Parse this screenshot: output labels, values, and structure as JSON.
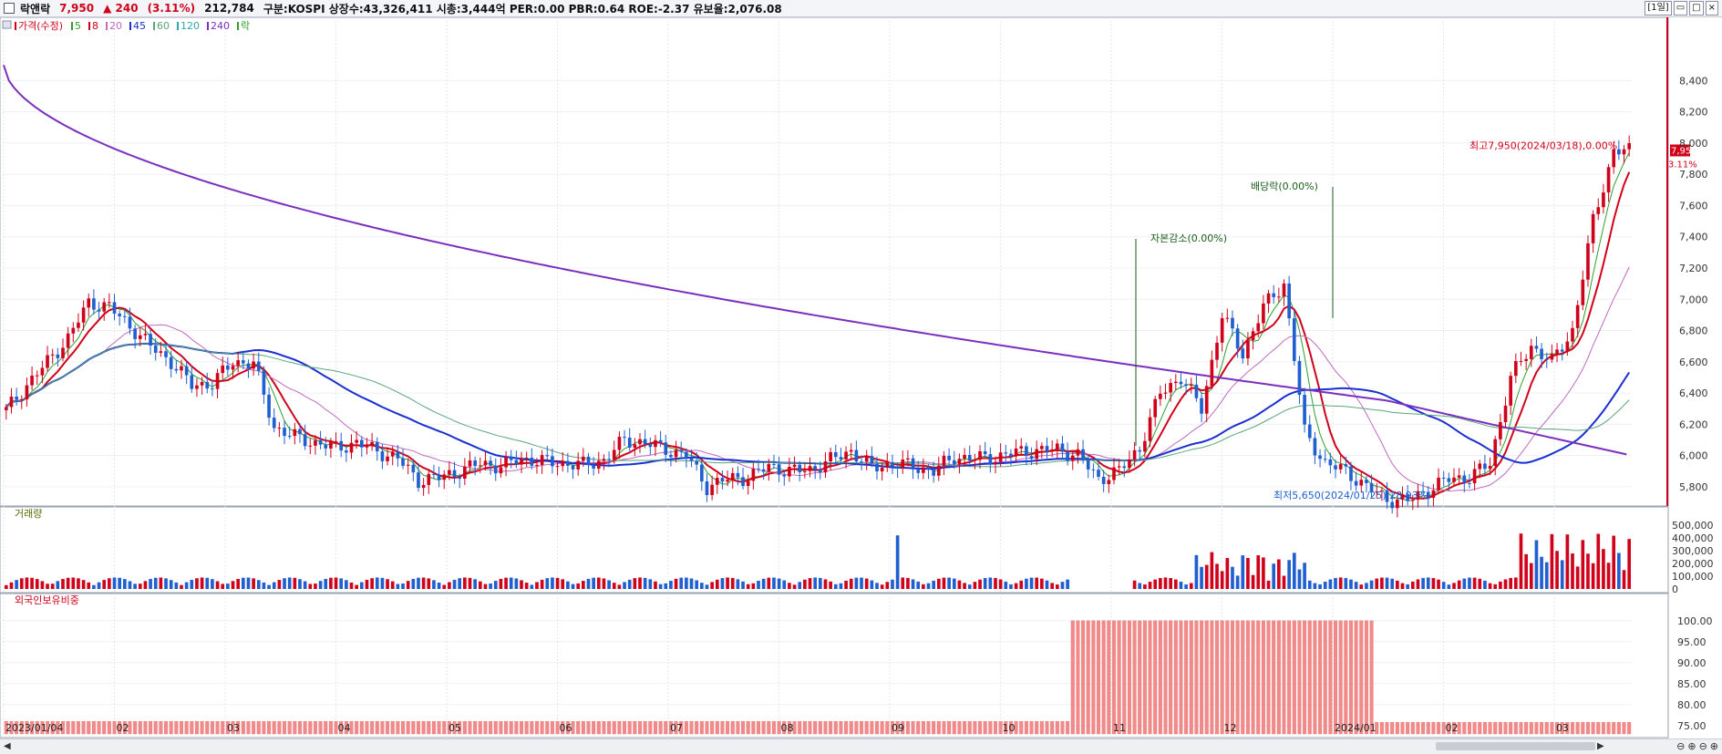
{
  "header": {
    "name": "락앤락",
    "price": "7,950",
    "change": "▲ 240",
    "change_pct": "(3.11%)",
    "volume": "212,784",
    "info": "구분:KOSPI 상장수:43,326,411 시총:3,444억 PER:0.00 PBR:0.64 ROE:-2.37 유보율:2,076.08",
    "period_button": "[1일]",
    "win_buttons": [
      "▭",
      "□",
      "×"
    ]
  },
  "colors": {
    "up": "#d0021b",
    "down": "#1f5fcf",
    "ma5": "#2ca02c",
    "ma8": "#d0021b",
    "ma20": "#c06ac0",
    "ma45": "#1a2fd0",
    "ma60": "#5aa57a",
    "ma240": "#7b2fbe",
    "foreign": "#f28a8a"
  },
  "legend": [
    {
      "label": "가격(수정)",
      "color": "#d0021b"
    },
    {
      "label": "5",
      "color": "#2ca02c"
    },
    {
      "label": "8",
      "color": "#d0021b"
    },
    {
      "label": "20",
      "color": "#c06ac0"
    },
    {
      "label": "45",
      "color": "#1a2fd0"
    },
    {
      "label": "60",
      "color": "#5aa57a"
    },
    {
      "label": "120",
      "color": "#2aa8a8"
    },
    {
      "label": "240",
      "color": "#7b2fbe"
    },
    {
      "label": "락",
      "color": "#2ca02c"
    }
  ],
  "chart_data": [
    {
      "type": "candlestick",
      "title": "가격(수정)",
      "ylim": [
        5700,
        8700
      ],
      "y_ticks": [
        5800,
        6000,
        6200,
        6400,
        6600,
        6800,
        7000,
        7200,
        7400,
        7600,
        7800,
        8000,
        8200,
        8400
      ],
      "y_tick_labels": [
        "5,800",
        "6,000",
        "6,200",
        "6,400",
        "6,600",
        "6,800",
        "7,000",
        "7,200",
        "7,400",
        "7,600",
        "7,800",
        "8,000",
        "8,200",
        "8,400"
      ],
      "x_labels": [
        "2023/01/04",
        "02",
        "03",
        "04",
        "05",
        "06",
        "07",
        "08",
        "09",
        "10",
        "11",
        "12",
        "2024/01",
        "02",
        "03"
      ],
      "last_price_label": "7,950",
      "last_pct_label": "3.11%",
      "close_series": [
        6290,
        6450,
        6600,
        6750,
        6980,
        6950,
        6830,
        6700,
        6600,
        6450,
        6460,
        6600,
        6590,
        6180,
        6120,
        6080,
        6050,
        6080,
        6030,
        5980,
        5840,
        5860,
        5900,
        5950,
        5930,
        5980,
        5960,
        5950,
        5940,
        5970,
        6100,
        6080,
        6040,
        6000,
        5800,
        5850,
        5860,
        5930,
        5900,
        5910,
        5970,
        6030,
        5920,
        5950,
        5930,
        5900,
        5990,
        5980,
        5990,
        6020,
        6030,
        6040,
        6000,
        5850,
        5900,
        6050,
        6400,
        6500,
        6300,
        6900,
        6650,
        6950,
        7100,
        6150,
        5950,
        5900,
        5800,
        5720,
        5710,
        5780,
        5850,
        5860,
        5950,
        6500,
        6700,
        6600,
        6800,
        7500,
        7950
      ],
      "annotations": [
        {
          "text": "최고7,950(2024/03/18),0.00%",
          "value": 7950
        },
        {
          "text": "배당락(0.00%)",
          "value": 7700
        },
        {
          "text": "자본감소(0.00%)",
          "value": 7350
        },
        {
          "text": "최저5,650(2024/01/25),28.93%",
          "value": 5650
        }
      ]
    },
    {
      "type": "bar",
      "title": "거래량",
      "ylim": [
        0,
        550000
      ],
      "y_ticks": [
        0,
        100000,
        200000,
        300000,
        400000,
        500000
      ],
      "y_tick_labels": [
        "0",
        "100,000",
        "200,000",
        "300,000",
        "400,000",
        "500,000"
      ]
    },
    {
      "type": "bar",
      "title": "외국인보유비중",
      "ylim": [
        73,
        103
      ],
      "y_ticks": [
        75,
        80,
        85,
        90,
        95,
        100
      ],
      "y_tick_labels": [
        "75.00",
        "80.00",
        "85.00",
        "90.00",
        "95.00",
        "100.00"
      ]
    }
  ],
  "scrollbar": {
    "left_arrow": "◀",
    "right_arrow": "▶",
    "zoom_icons": [
      "⊖",
      "⊕",
      "⊖",
      "⊕"
    ]
  }
}
